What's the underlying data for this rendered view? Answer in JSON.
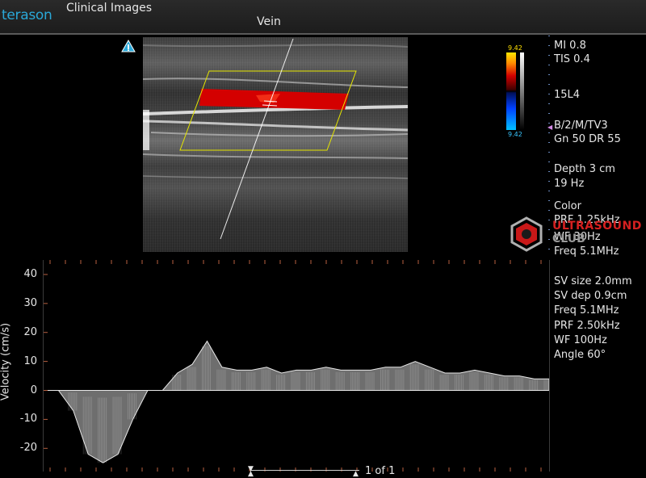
{
  "header": {
    "logo": "terason",
    "app_title": "Clinical Images",
    "study_title": "Vein"
  },
  "color_scale": {
    "top": "9.42",
    "bottom": "9.42"
  },
  "params_top": [
    "MI  0.8",
    "TIS 0.4",
    "15L4",
    "B/2/M/TV3",
    "Gn 50   DR 55",
    "Depth 3 cm",
    "19 Hz",
    "Color",
    "PRF 1.25kHz",
    "WF 30Hz",
    "Freq 5.1MHz"
  ],
  "params_doppler": [
    "SV size 2.0mm",
    "SV dep 0.9cm",
    "Freq 5.1MHz",
    "PRF 2.50kHz",
    "WF 100Hz",
    "Angle 60°"
  ],
  "watermark": {
    "line1": "ULTRASOUND",
    "line2": "CLUB"
  },
  "doppler": {
    "y_axis_label": "Velocity (cm/s)",
    "y_ticks": [
      "40",
      "30",
      "20",
      "10",
      "0",
      "-10",
      "-20"
    ]
  },
  "pager": {
    "text": "1 of 1"
  },
  "colors": {
    "accent": "#2aa8d8",
    "flow": "#d40000",
    "roi": "#e6e600"
  },
  "chart_data": {
    "type": "area",
    "title": "",
    "xlabel": "",
    "ylabel": "Velocity (cm/s)",
    "ylim": [
      -28,
      45
    ],
    "yticks": [
      40,
      30,
      20,
      10,
      0,
      -10,
      -20
    ],
    "grid": false,
    "series": [
      {
        "values": [
          0,
          0,
          -7,
          -22,
          -25,
          -22,
          -10,
          0,
          0,
          6,
          9,
          17,
          8,
          7,
          7,
          8,
          6,
          7,
          7,
          8,
          7,
          7,
          7,
          8,
          8,
          10,
          8,
          6,
          6,
          7,
          6,
          5,
          5,
          4,
          4
        ]
      }
    ]
  }
}
